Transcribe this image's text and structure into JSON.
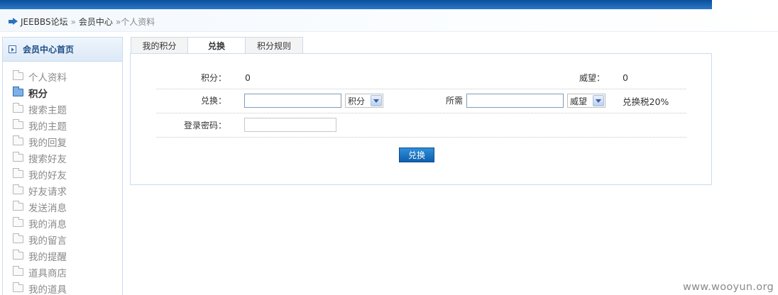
{
  "breadcrumb": {
    "items": [
      "JEEBBS论坛",
      "会员中心"
    ],
    "separator": "»",
    "current": "»个人资料"
  },
  "sidebar": {
    "header": "会员中心首页",
    "items": [
      {
        "label": "个人资料",
        "active": false
      },
      {
        "label": "积分",
        "active": true
      },
      {
        "label": "搜索主题",
        "active": false
      },
      {
        "label": "我的主题",
        "active": false
      },
      {
        "label": "我的回复",
        "active": false
      },
      {
        "label": "搜索好友",
        "active": false
      },
      {
        "label": "我的好友",
        "active": false
      },
      {
        "label": "好友请求",
        "active": false
      },
      {
        "label": "发送消息",
        "active": false
      },
      {
        "label": "我的消息",
        "active": false
      },
      {
        "label": "我的留言",
        "active": false
      },
      {
        "label": "我的提醒",
        "active": false
      },
      {
        "label": "道具商店",
        "active": false
      },
      {
        "label": "我的道具",
        "active": false
      }
    ]
  },
  "tabs": [
    {
      "label": "我的积分",
      "active": false
    },
    {
      "label": "兑换",
      "active": true
    },
    {
      "label": "积分规则",
      "active": false
    }
  ],
  "form": {
    "points_label": "积分：",
    "points_value": "0",
    "prestige_label": "威望：",
    "prestige_value": "0",
    "exchange_label": "兑换：",
    "exchange_value": "",
    "exchange_unit": "积分",
    "required_label": "所需",
    "required_value": "",
    "required_unit": "威望",
    "tax_text": "兑换税20%",
    "password_label": "登录密码：",
    "password_value": "",
    "submit_label": "兑换"
  },
  "watermark": "www.wooyun.org",
  "colors": {
    "accent": "#2a72c2",
    "topbar": "#0a4f9c",
    "button": "#0e5fae",
    "border": "#c9dbee"
  }
}
